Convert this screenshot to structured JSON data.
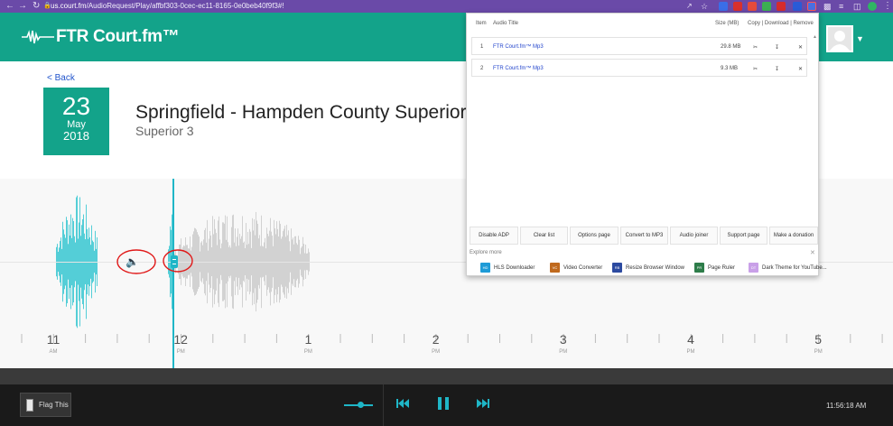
{
  "browser": {
    "url_host": "us.court.fm",
    "url_path": "/AudioRequest/Play/affbf303-0cec-ec11-8165-0e0beb40f9f3#!"
  },
  "header": {
    "logo_text": "FTR Court.fm™"
  },
  "nav": {
    "back_label": "< Back"
  },
  "date": {
    "day": "23",
    "month": "May",
    "year": "2018"
  },
  "title": "Springfield - Hampden County Superior",
  "subtitle": "Superior 3",
  "timeline": {
    "ticks": [
      {
        "label": "11",
        "ampm": "AM"
      },
      {
        "label": "12",
        "ampm": "PM"
      },
      {
        "label": "1",
        "ampm": "PM"
      },
      {
        "label": "2",
        "ampm": "PM"
      },
      {
        "label": "3",
        "ampm": "PM"
      },
      {
        "label": "4",
        "ampm": "PM"
      },
      {
        "label": "5",
        "ampm": "PM"
      }
    ]
  },
  "footer": {
    "flag_label": "Flag This",
    "clock": "11:56:18 AM"
  },
  "popup": {
    "headers": {
      "item": "Item",
      "audio_title": "Audio Title",
      "size": "Size (MB)",
      "actions": "Copy | Download | Remove"
    },
    "rows": [
      {
        "item": "1",
        "title": "FTR Court.fm™ Mp3",
        "size": "29.8 MB"
      },
      {
        "item": "2",
        "title": "FTR Court.fm™ Mp3",
        "size": "9.3 MB"
      }
    ],
    "buttons": [
      "Disable ADP",
      "Clear list",
      "Options page",
      "Convert to MP3",
      "Audio joiner",
      "Support page",
      "Make a donation"
    ],
    "explore_label": "Explore more",
    "explore_items": [
      {
        "abbr": "HD",
        "label": "HLS Downloader",
        "color": "#1e9bd7"
      },
      {
        "abbr": "VC",
        "label": "Video Converter",
        "color": "#c06a1e"
      },
      {
        "abbr": "RB",
        "label": "Resize Browser Window",
        "color": "#2c4aa0"
      },
      {
        "abbr": "PR",
        "label": "Page Ruler",
        "color": "#2e7d4a"
      },
      {
        "abbr": "DT",
        "label": "Dark Theme for YouTube...",
        "color": "#c9a0e8"
      }
    ]
  },
  "colors": {
    "brand": "#13a38a",
    "waveform_played": "#2bc4cf",
    "waveform_unplayed": "#c8c8c8",
    "annotation": "#e01818"
  }
}
